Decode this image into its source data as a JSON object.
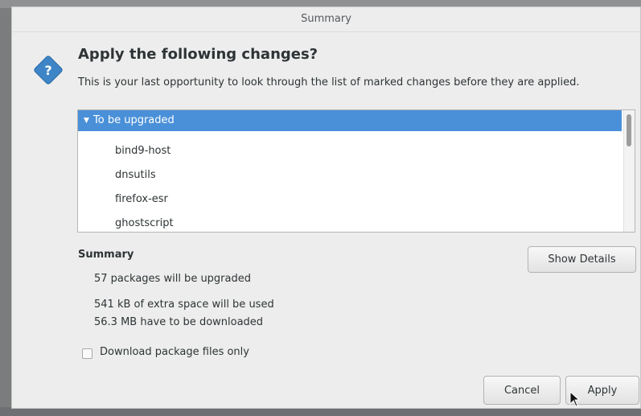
{
  "window": {
    "title": "Summary"
  },
  "dialog": {
    "heading": "Apply the following changes?",
    "description": "This is your last opportunity to look through the list of marked changes before they are applied."
  },
  "changes": {
    "group_label": "To be upgraded",
    "packages": [
      "bind9-host",
      "dnsutils",
      "firefox-esr",
      "ghostscript"
    ]
  },
  "summary": {
    "label": "Summary",
    "upgraded": "57 packages will be upgraded",
    "space": "541 kB of extra space will be used",
    "download": "56.3 MB have to be downloaded",
    "show_details_label": "Show Details"
  },
  "options": {
    "download_only_label": "Download package files only",
    "download_only_checked": false
  },
  "buttons": {
    "cancel_label": "Cancel",
    "apply_label": "Apply"
  },
  "colors": {
    "selection": "#4a90d9",
    "icon_blue": "#3d85c6"
  },
  "icons": {
    "dialog_icon": "question-icon",
    "expand": "triangle-down-icon"
  }
}
